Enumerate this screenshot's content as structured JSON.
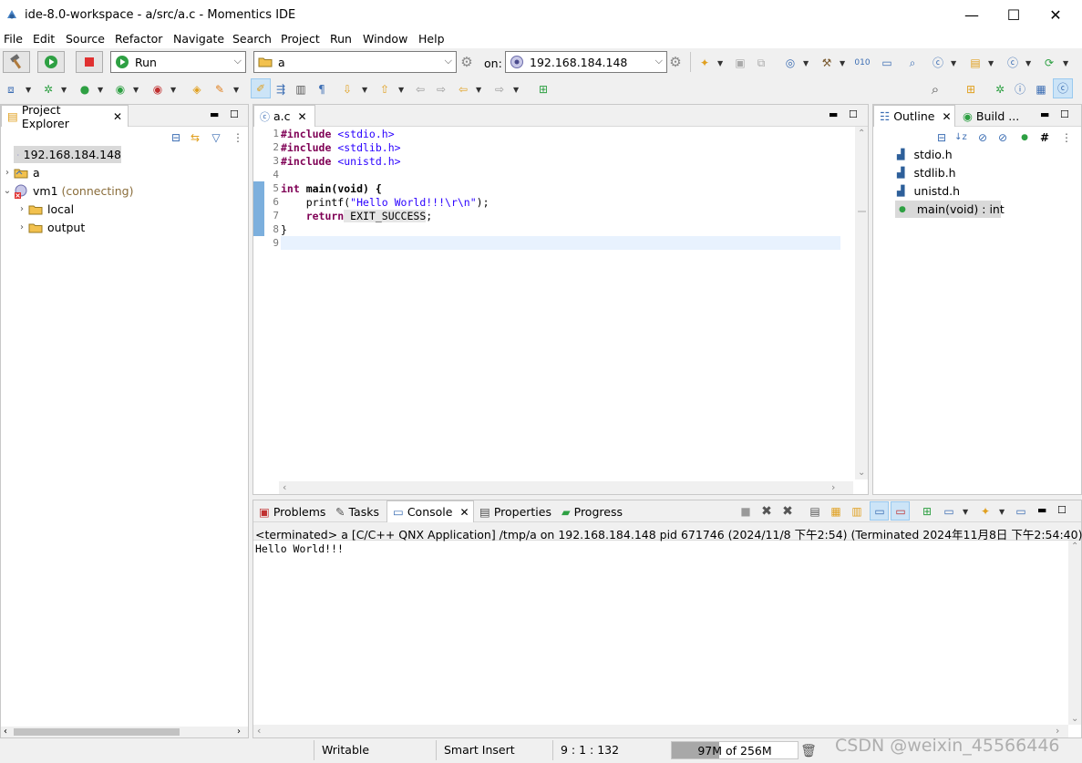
{
  "window": {
    "title": "ide-8.0-workspace - a/src/a.c - Momentics IDE",
    "minimize": "—",
    "maximize": "☐",
    "close": "✕"
  },
  "menu": [
    "File",
    "Edit",
    "Source",
    "Refactor",
    "Navigate",
    "Search",
    "Project",
    "Run",
    "Window",
    "Help"
  ],
  "toolbar": {
    "launch_mode": "Run",
    "launch_config": "a",
    "on_label": "on:",
    "target": "192.168.184.148"
  },
  "project_explorer": {
    "tab_label": "Project Explorer",
    "items": [
      {
        "label": "192.168.184.148",
        "status": ""
      },
      {
        "label": "a",
        "status": ""
      },
      {
        "label": "vm1",
        "status": "(connecting)"
      },
      {
        "label": "local",
        "status": ""
      },
      {
        "label": "output",
        "status": ""
      }
    ]
  },
  "editor": {
    "tab_label": "a.c",
    "line_numbers": [
      "1",
      "2",
      "3",
      "4",
      "5",
      "6",
      "7",
      "8",
      "9"
    ],
    "lines": [
      {
        "a": "#include",
        "b": " <stdio.h>"
      },
      {
        "a": "#include",
        "b": " <stdlib.h>"
      },
      {
        "a": "#include",
        "b": " <unistd.h>"
      },
      {
        "a": "",
        "b": ""
      },
      {
        "a": "int",
        "b": " main(void) {"
      },
      {
        "a": "    printf(",
        "b": "\"Hello World!!!\\r\\n\"",
        "c": ");"
      },
      {
        "a": "    return",
        "b": " EXIT_SUCCESS",
        "c": ";"
      },
      {
        "a": "}",
        "b": ""
      },
      {
        "a": "",
        "b": ""
      }
    ]
  },
  "outline": {
    "tab_label": "Outline",
    "build_tab_label": "Build ...",
    "items": [
      "stdio.h",
      "stdlib.h",
      "unistd.h",
      "main(void) : int"
    ]
  },
  "bottom": {
    "tabs": [
      "Problems",
      "Tasks",
      "Console",
      "Properties",
      "Progress"
    ],
    "console_header": "<terminated> a [C/C++ QNX Application] /tmp/a on 192.168.184.148 pid 671746 (2024/11/8 下午2:54) (Terminated 2024年11月8日 下午2:54:40)",
    "console_output": "Hello World!!!"
  },
  "status": {
    "writable": "Writable",
    "insert_mode": "Smart Insert",
    "position": "9 : 1 : 132",
    "heap": "97M of 256M",
    "heap_fraction": 0.38
  },
  "watermark": "CSDN @weixin_45566446"
}
